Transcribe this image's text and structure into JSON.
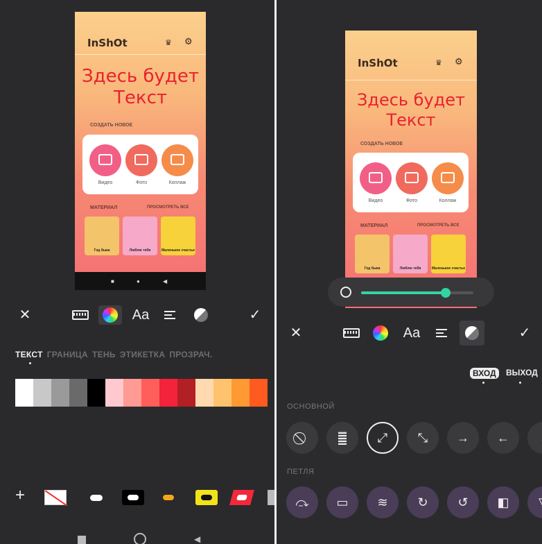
{
  "left": {
    "phone": {
      "logo": "InShOt",
      "big_text_line1": "Здесь будет",
      "big_text_line2": "Текст",
      "create_new": "СОЗДАТЬ НОВОЕ",
      "video": "Видео",
      "photo": "Фото",
      "collage": "Коллаж",
      "material": "МАТЕРИАЛ",
      "view_all": "ПРОСМОТРЕТЬ ВСЕ",
      "thumb1": "Год быка",
      "thumb2": "Люблю тебя",
      "thumb3": "Маленькое счастье"
    },
    "tabs": [
      "ТЕКСТ",
      "ГРАНИЦА",
      "ТЕНЬ",
      "ЭТИКЕТКА",
      "ПРОЗРАЧ."
    ],
    "tb": {
      "font_label": "Aa",
      "close": "✕",
      "confirm": "✓"
    },
    "palette": [
      "#ffffff",
      "#c8c8c8",
      "#9a9a9a",
      "#6a6a6a",
      "#000000",
      "#ffc9cf",
      "#ff9a94",
      "#ff5e5b",
      "#f2233a",
      "#b21f24",
      "#ffd9b0",
      "#ffc36d",
      "#ff9933",
      "#ff5a1f"
    ],
    "plus": "+"
  },
  "right": {
    "phone": {
      "logo": "InShOt",
      "big_text_line1": "Здесь будет",
      "big_text_line2": "Текст",
      "create_new": "СОЗДАТЬ НОВОЕ",
      "video": "Видео",
      "photo": "Фото",
      "collage": "Коллаж",
      "material": "МАТЕРИАЛ",
      "view_all": "ПРОСМОТРЕТЬ ВСЕ",
      "thumb1": "Год быка",
      "thumb2": "Люблю тебя",
      "thumb3": "Маленькое счастье"
    },
    "tb": {
      "font_label": "Aa",
      "close": "✕",
      "confirm": "✓"
    },
    "slider_value": 0.75,
    "in_label": "ВХОД",
    "out_label": "ВЫХОД",
    "basic_label": "ОСНОВНОЙ",
    "loop_label": "ПЕТЛЯ"
  }
}
